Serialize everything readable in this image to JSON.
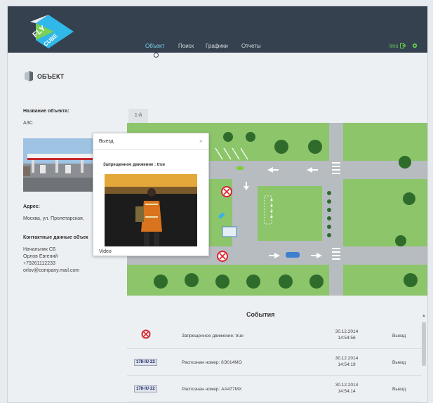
{
  "header": {
    "logo_text_top": "FLY",
    "logo_text_bottom": "CUBE",
    "nav": [
      "Объект",
      "Поиск",
      "Графики",
      "Отчеты"
    ],
    "active_tab": "Объект",
    "user": "lms"
  },
  "page": {
    "title": "ОБЪЕКТ"
  },
  "object": {
    "name_label": "Название объекта:",
    "name": "АЗС",
    "address_label": "Адрес:",
    "address": "Москва, ул. Пролетарская,",
    "contacts_label": "Контактные данные объек",
    "contacts": [
      "Начальник СБ",
      "Орлов Евгений",
      "+79261112233",
      "orlov@company.mail.com"
    ]
  },
  "map": {
    "tab": "1-й"
  },
  "popup": {
    "title": "Выезд",
    "close": "×",
    "message": "Запрещенное движение : true",
    "video_label": "Video"
  },
  "events": {
    "title": "События",
    "rows": [
      {
        "kind": "forbidden",
        "plate": "",
        "text": "Запрещенное движение: true",
        "date": "30.12.2014",
        "time": "14:54:56",
        "type": "Выезд"
      },
      {
        "kind": "plate",
        "plate": "178·IU·22",
        "text": "Распознан номер: 8Э014МО",
        "date": "30.12.2014",
        "time": "14:54:19",
        "type": "Выезд"
      },
      {
        "kind": "plate",
        "plate": "178·IU·22",
        "text": "Распознан номер: АА477МХ",
        "date": "30.12.2014",
        "time": "14:54:14",
        "type": "Выезд"
      }
    ]
  },
  "colors": {
    "header_bg": "#35414e",
    "nav_active": "#7fd6f4",
    "user_green": "#5ec84f",
    "grass": "#8cc56a",
    "road": "#b7bcc1",
    "tree": "#2f6b2b",
    "forbidden_red": "#d8262f"
  }
}
